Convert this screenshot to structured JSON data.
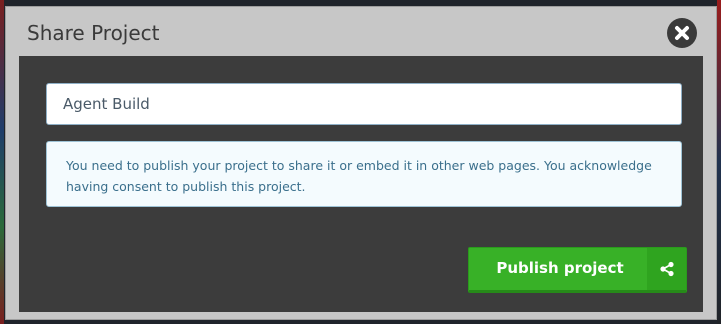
{
  "dialog": {
    "title": "Share Project",
    "close_icon": "close-icon",
    "project_name": {
      "value": "Agent Build",
      "placeholder": ""
    },
    "notice_text": "You need to publish your project to share it or embed it in other web pages. You acknowledge having consent to publish this project.",
    "publish_button": {
      "label": "Publish project",
      "icon": "share-icon"
    }
  },
  "colors": {
    "header_bg": "#c7c7c7",
    "body_bg": "#3c3c3c",
    "notice_bg": "#f4fbfe",
    "notice_text": "#3a6f8c",
    "publish_green": "#38b127"
  }
}
